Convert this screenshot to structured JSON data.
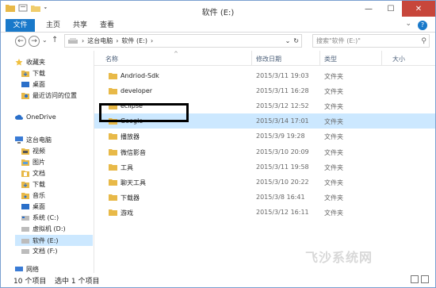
{
  "window": {
    "title": "软件 (E:)"
  },
  "titlebar": {
    "minimize": "—",
    "maximize": "☐",
    "close": "✕"
  },
  "ribbon": {
    "tabs": [
      "文件",
      "主页",
      "共享",
      "查看"
    ],
    "expand": "⌄",
    "help": "?"
  },
  "address": {
    "back": "←",
    "forward": "→",
    "recent": "⌄",
    "up": "↑",
    "segments": [
      "这台电脑",
      "›",
      "软件 (E:)",
      "›"
    ],
    "dropdown": "⌄",
    "refresh": "↻",
    "search_placeholder": "搜索\"软件 (E:)\""
  },
  "sidebar": {
    "favorites_label": "收藏夹",
    "favorites": [
      "下载",
      "桌面",
      "最近访问的位置"
    ],
    "onedrive": "OneDrive",
    "thispc": "这台电脑",
    "thispc_items": [
      "视频",
      "图片",
      "文档",
      "下载",
      "音乐",
      "桌面",
      "系统 (C:)",
      "虚拟机 (D:)",
      "软件 (E:)",
      "文档 (F:)"
    ],
    "network": "网络"
  },
  "columns": {
    "name": "名称",
    "date": "修改日期",
    "type": "类型",
    "size": "大小"
  },
  "files": [
    {
      "name": "Andriod-Sdk",
      "date": "2015/3/11 19:03",
      "type": "文件夹"
    },
    {
      "name": "developer",
      "date": "2015/3/11 16:28",
      "type": "文件夹"
    },
    {
      "name": "eclipse",
      "date": "2015/3/12 12:52",
      "type": "文件夹"
    },
    {
      "name": "Google",
      "date": "2015/3/14 17:01",
      "type": "文件夹"
    },
    {
      "name": "播放器",
      "date": "2015/3/9 19:28",
      "type": "文件夹"
    },
    {
      "name": "微信影音",
      "date": "2015/3/10 20:09",
      "type": "文件夹"
    },
    {
      "name": "工具",
      "date": "2015/3/11 19:58",
      "type": "文件夹"
    },
    {
      "name": "聊天工具",
      "date": "2015/3/10 20:22",
      "type": "文件夹"
    },
    {
      "name": "下载器",
      "date": "2015/3/8 16:41",
      "type": "文件夹"
    },
    {
      "name": "游戏",
      "date": "2015/3/12 16:11",
      "type": "文件夹"
    }
  ],
  "status": {
    "count": "10 个项目",
    "selected": "选中 1 个项目"
  },
  "watermark": "飞沙系统网",
  "colors": {
    "accent": "#1979ca",
    "selection": "#cce8ff",
    "folder": "#e8b948",
    "close": "#c7463b"
  }
}
